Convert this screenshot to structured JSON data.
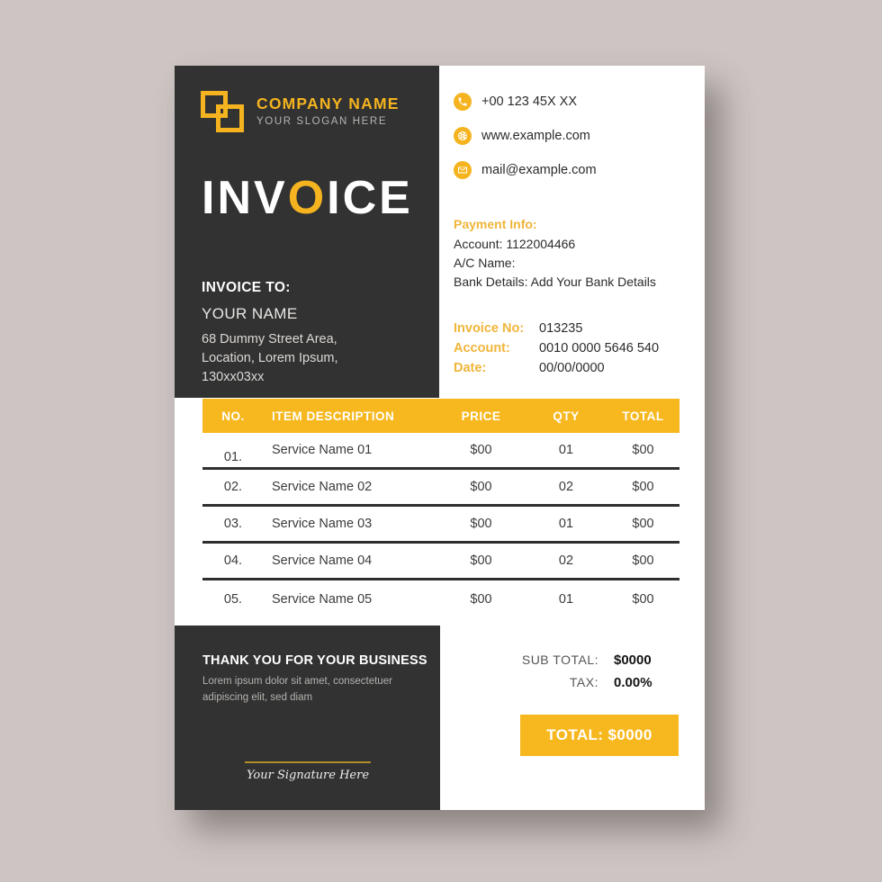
{
  "colors": {
    "accent_yellow": "#f7b81f",
    "dark_panel": "#323232",
    "page_background": "#cdc5c3",
    "sheet": "#ffffff",
    "signature_line": "#b08c2a"
  },
  "brand": {
    "logo_icon": "two-overlapping-squares-icon",
    "name": "COMPANY NAME",
    "slogan": "YOUR SLOGAN HERE"
  },
  "title": {
    "part1": "INV",
    "highlight": "O",
    "part2": "ICE"
  },
  "invoice_to": {
    "label": "INVOICE TO:",
    "name": "YOUR NAME",
    "address": "68 Dummy Street Area,\nLocation, Lorem Ipsum,\n130xx03xx"
  },
  "contacts": [
    {
      "icon": "phone-icon",
      "text": "+00 123 45X XX"
    },
    {
      "icon": "globe-icon",
      "text": "www.example.com"
    },
    {
      "icon": "envelope-icon",
      "text": "mail@example.com"
    }
  ],
  "payment_info": {
    "heading": "Payment Info:",
    "account": "Account: 1122004466",
    "ac_name": "A/C Name:",
    "bank_details": "Bank Details: Add Your Bank Details"
  },
  "meta": [
    {
      "key": "Invoice No:",
      "value": "013235"
    },
    {
      "key": "Account:",
      "value": "0010 0000 5646 540"
    },
    {
      "key": "Date:",
      "value": "00/00/0000"
    }
  ],
  "table": {
    "columns": [
      "NO.",
      "ITEM DESCRIPTION",
      "PRICE",
      "QTY",
      "TOTAL"
    ],
    "rows": [
      {
        "no": "01.",
        "desc": "Service Name 01",
        "price": "$00",
        "qty": "01",
        "total": "$00"
      },
      {
        "no": "02.",
        "desc": "Service Name 02",
        "price": "$00",
        "qty": "02",
        "total": "$00"
      },
      {
        "no": "03.",
        "desc": "Service Name 03",
        "price": "$00",
        "qty": "01",
        "total": "$00"
      },
      {
        "no": "04.",
        "desc": "Service Name 04",
        "price": "$00",
        "qty": "02",
        "total": "$00"
      },
      {
        "no": "05.",
        "desc": "Service Name 05",
        "price": "$00",
        "qty": "01",
        "total": "$00"
      }
    ]
  },
  "thanks": {
    "title": "THANK YOU FOR YOUR BUSINESS",
    "subtitle": "Lorem ipsum dolor sit amet, consectetuer\nadipiscing elit, sed diam"
  },
  "totals": {
    "rows": [
      {
        "key": "SUB TOTAL:",
        "value": "$0000"
      },
      {
        "key": "TAX:",
        "value": "0.00%"
      }
    ],
    "grand_total": "TOTAL: $0000"
  },
  "signature": {
    "text": "Your Signature Here"
  }
}
